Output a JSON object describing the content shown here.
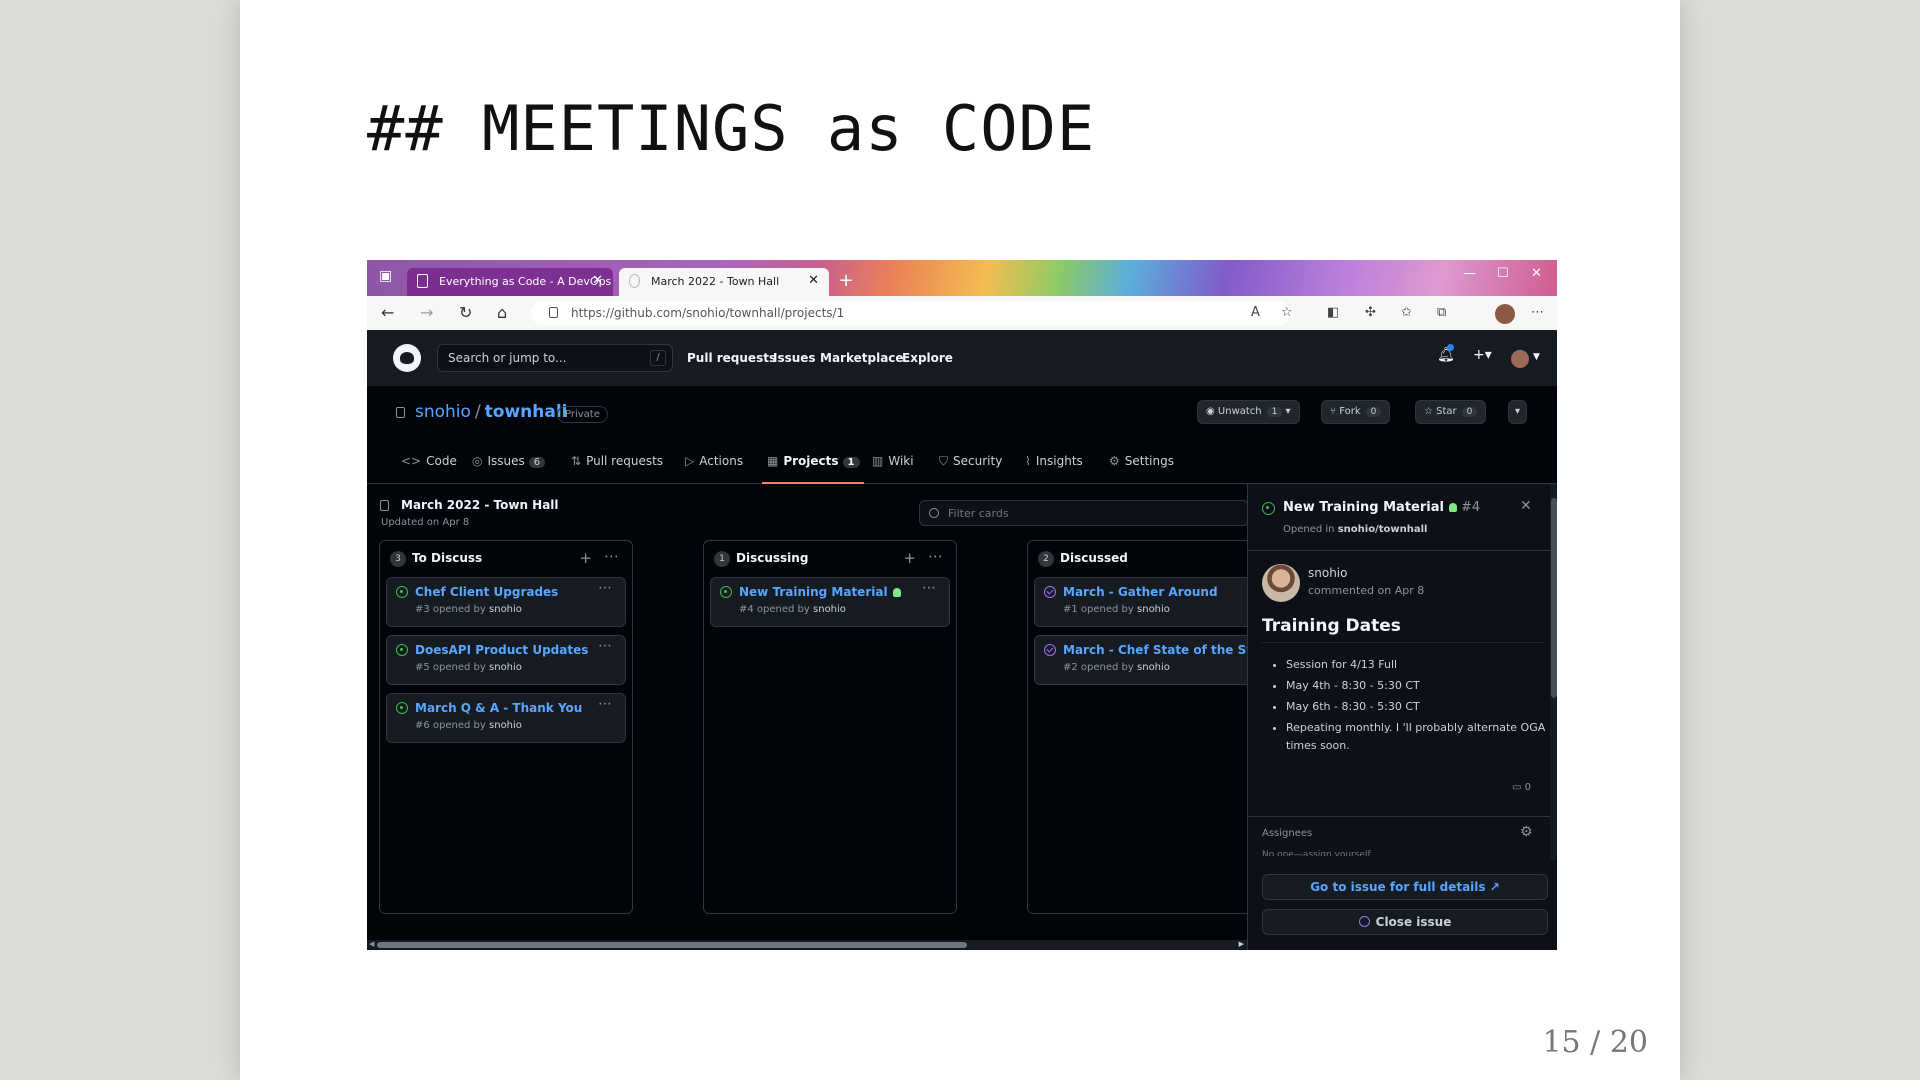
{
  "slide": {
    "title": "## MEETINGS as CODE",
    "page_number": "15 / 20"
  },
  "browser": {
    "tabs": [
      {
        "label": "Everything as Code - A DevOps I",
        "active": false
      },
      {
        "label": "March 2022 - Town Hall",
        "active": true
      }
    ],
    "url": "https://github.com/snohio/townhall/projects/1"
  },
  "github": {
    "search_placeholder": "Search or jump to...",
    "search_shortcut": "/",
    "nav": [
      "Pull requests",
      "Issues",
      "Marketplace",
      "Explore"
    ],
    "repo": {
      "owner": "snohio",
      "separator": "/",
      "name": "townhall",
      "visibility": "Private",
      "unwatch_label": "Unwatch",
      "unwatch_count": "1",
      "fork_label": "Fork",
      "fork_count": "0",
      "star_label": "Star",
      "star_count": "0"
    },
    "repo_tabs": [
      {
        "label": "Code",
        "count": "",
        "icon": "code-icon"
      },
      {
        "label": "Issues",
        "count": "6",
        "icon": "issue-icon"
      },
      {
        "label": "Pull requests",
        "count": "",
        "icon": "pull-request-icon"
      },
      {
        "label": "Actions",
        "count": "",
        "icon": "play-icon"
      },
      {
        "label": "Projects",
        "count": "1",
        "icon": "table-icon",
        "selected": true
      },
      {
        "label": "Wiki",
        "count": "",
        "icon": "book-icon"
      },
      {
        "label": "Security",
        "count": "",
        "icon": "shield-icon"
      },
      {
        "label": "Insights",
        "count": "",
        "icon": "graph-icon"
      },
      {
        "label": "Settings",
        "count": "",
        "icon": "gear-icon"
      }
    ]
  },
  "project": {
    "title": "March 2022 - Town Hall",
    "updated": "Updated on Apr 8",
    "filter_placeholder": "Filter cards",
    "columns": [
      {
        "name": "To Discuss",
        "count": "3",
        "cards": [
          {
            "title": "Chef Client Upgrades",
            "meta_prefix": "#3 opened by",
            "author": "snohio",
            "state": "open"
          },
          {
            "title": "DoesAPI Product Updates",
            "meta_prefix": "#5 opened by",
            "author": "snohio",
            "state": "open"
          },
          {
            "title": "March Q & A - Thank You",
            "meta_prefix": "#6 opened by",
            "author": "snohio",
            "state": "open"
          }
        ]
      },
      {
        "name": "Discussing",
        "count": "1",
        "cards": [
          {
            "title": "New Training Material",
            "meta_prefix": "#4 opened by",
            "author": "snohio",
            "state": "open"
          }
        ]
      },
      {
        "name": "Discussed",
        "count": "2",
        "cards": [
          {
            "title": "March - Gather Around",
            "meta_prefix": "#1 opened by",
            "author": "snohio",
            "state": "closed"
          },
          {
            "title": "March - Chef State of the State",
            "meta_prefix": "#2 opened by",
            "author": "snohio",
            "state": "closed"
          }
        ]
      }
    ]
  },
  "issue_panel": {
    "title": "New Training Material",
    "number": "#4",
    "opened_prefix": "Opened in",
    "opened_repo": "snohio/townhall",
    "author": "snohio",
    "commented": "commented on Apr 8",
    "heading": "Training Dates",
    "items": [
      "Session for 4/13 Full",
      "May 4th - 8:30 - 5:30 CT",
      "May 6th - 8:30 - 5:30 CT",
      "Repeating monthly. I 'll probably alternate OGA times soon."
    ],
    "comment_count": "0",
    "assignees_label": "Assignees",
    "assignees_value": "No one—assign yourself",
    "details_button": "Go to issue for full details",
    "close_button": "Close issue"
  }
}
